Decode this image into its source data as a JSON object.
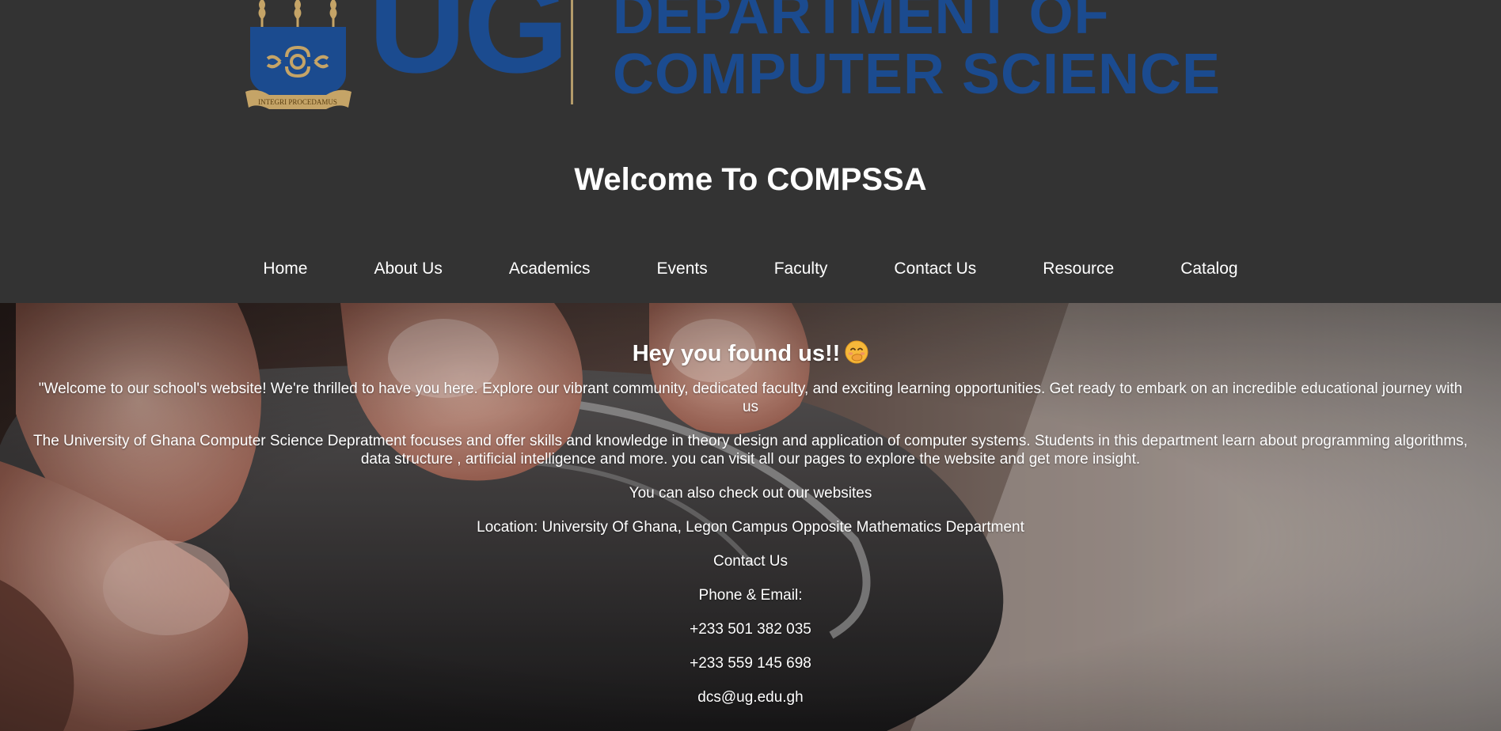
{
  "logo": {
    "short_name": "UG",
    "department_line1": "DEPARTMENT OF",
    "department_line2": "COMPUTER SCIENCE",
    "motto": "INTEGRI PROCEDAMUS"
  },
  "header": {
    "title": "Welcome To COMPSSA"
  },
  "nav": {
    "items": [
      "Home",
      "About Us",
      "Academics",
      "Events",
      "Faculty",
      "Contact Us",
      "Resource",
      "Catalog"
    ]
  },
  "hero": {
    "heading": "Hey you found us!!",
    "intro": "\"Welcome to our school's website! We're thrilled to have you here. Explore our vibrant community, dedicated faculty, and exciting learning opportunities. Get ready to embark on an incredible educational journey with us",
    "about": "The University of Ghana Computer Science Depratment focuses and offer skills and knowledge in theory design and application of computer systems. Students in this department learn about programming algorithms, data structure , artificial intelligence and more. you can visit all our pages to explore the website and get more insight.",
    "websites": "You can also check out our websites",
    "location": "Location: University Of Ghana, Legon Campus Opposite Mathematics Department",
    "contact_heading": "Contact Us",
    "phone_email_label": "Phone & Email:",
    "phone1": "+233 501 382 035",
    "phone2": "+233 559 145 698",
    "email": "dcs@ug.edu.gh"
  },
  "colors": {
    "header_bg": "#333333",
    "logo_blue": "#1b4b8f",
    "logo_gold": "#b39b6a",
    "text": "#ffffff"
  },
  "icons": {
    "crest": "university-crest-icon",
    "emoji": "hand-over-mouth-emoji-icon"
  }
}
